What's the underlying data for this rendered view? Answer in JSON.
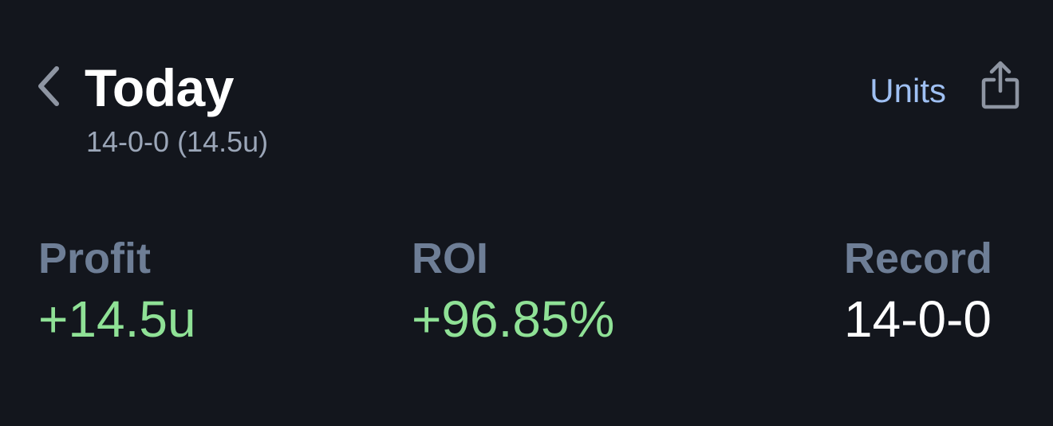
{
  "header": {
    "title": "Today",
    "subtitle": "14-0-0 (14.5u)",
    "units_label": "Units",
    "back_icon": "chevron-left-icon",
    "share_icon": "share-icon"
  },
  "stats": {
    "profit": {
      "label": "Profit",
      "value": "+14.5u"
    },
    "roi": {
      "label": "ROI",
      "value": "+96.85%"
    },
    "record": {
      "label": "Record",
      "value": "14-0-0"
    }
  },
  "colors": {
    "background": "#13161d",
    "accent": "#9fc0f3",
    "positive": "#8fe196",
    "muted_label": "#6e7e96",
    "subtitle": "#9ba6b8"
  }
}
